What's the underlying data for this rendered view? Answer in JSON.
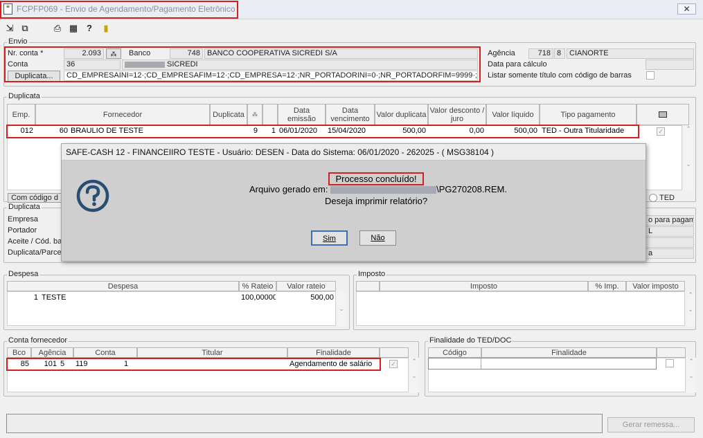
{
  "window": {
    "title": "FCPFP069 - Envio de Agendamento/Pagamento Eletrônico",
    "close_icon": "close-icon"
  },
  "toolbar": {
    "icons": [
      "exit-icon",
      "refresh-icon",
      "print-icon",
      "calculator-icon",
      "help-icon",
      "door-icon"
    ]
  },
  "envio": {
    "label": "Envio",
    "nr_conta_label": "Nr. conta *",
    "nr_conta_value": "2.093",
    "banco_label": "Banco",
    "banco_code": "748",
    "banco_name": "BANCO COOPERATIVA SICREDI S/A",
    "conta_label": "Conta",
    "conta_value": "36",
    "conta_name": "SICREDI",
    "duplicata_button": "Duplicata...",
    "filter_text": "CD_EMPRESAINI=12·;CD_EMPRESAFIM=12·;CD_EMPRESA=12·;NR_PORTADORINI=0·;NR_PORTADORFIM=9999·;NR_PORTAD",
    "agencia_label": "Agência",
    "agencia_value": "718",
    "agencia_digit": "8",
    "agencia_name": "CIANORTE",
    "data_calc_label": "Data para cálculo",
    "barcode_only_label": "Listar somente título com código de barras"
  },
  "duplicata_grid": {
    "label": "Duplicata",
    "headers": [
      "Emp.",
      "Fornecedor",
      "Duplicata",
      "",
      "",
      "Data emissão",
      "Data vencimento",
      "Valor duplicata",
      "Valor desconto / juro",
      "Valor líquido",
      "Tipo pagamento",
      ""
    ],
    "row": {
      "emp": "012",
      "forn_code": "60",
      "forn_name": "BRAULIO DE TESTE",
      "duplicata": "9",
      "parcela": "1",
      "emissao": "06/01/2020",
      "vencimento": "15/04/2020",
      "valor": "500,00",
      "desconto": "0,00",
      "liquido": "500,00",
      "tipo": "TED - Outra Titularidade"
    },
    "com_codigo_label": "Com código d",
    "ted_label": "TED"
  },
  "duplicata_detail": {
    "label": "Duplicata",
    "empresa_label": "Empresa",
    "portador_label": "Portador",
    "aceite_label": "Aceite / Cód. ba",
    "parcela_label": "Duplicata/Parce",
    "right_text_1": "o para pagame",
    "right_text_2": "L",
    "right_text_3": "a"
  },
  "dialog": {
    "title": "SAFE-CASH 12 - FINANCEIIRO TESTE - Usuário: DESEN - Data do Sistema: 06/01/2020 - 262025 - ( MSG38104 )",
    "line1": "Processo concluído!",
    "line2_prefix": "Arquivo gerado em:",
    "line2_suffix": "\\PG270208.REM.",
    "line3": "Deseja imprimir relatório?",
    "yes_button": "Sim",
    "no_button": "Não",
    "icon": "question-icon"
  },
  "despesa": {
    "label": "Despesa",
    "headers": [
      "Despesa",
      "% Rateio",
      "Valor rateio"
    ],
    "row": {
      "code": "1",
      "name": "TESTE",
      "rateio": "100,00000",
      "valor": "500,00"
    }
  },
  "imposto": {
    "label": "Imposto",
    "headers": [
      "Imposto",
      "% Imp.",
      "Valor imposto"
    ]
  },
  "conta_fornecedor": {
    "label": "Conta fornecedor",
    "headers": [
      "Bco",
      "Agência",
      "Conta",
      "Titular",
      "Finalidade"
    ],
    "row": {
      "bco": "85",
      "agencia": "101",
      "ag_digit": "5",
      "conta": "119",
      "conta_digit": "1",
      "titular": "",
      "finalidade": "Agendamento de salário"
    }
  },
  "finalidade_ted": {
    "label": "Finalidade do TED/DOC",
    "headers": [
      "Código",
      "Finalidade"
    ]
  },
  "footer": {
    "gerar_button": "Gerar remessa..."
  }
}
